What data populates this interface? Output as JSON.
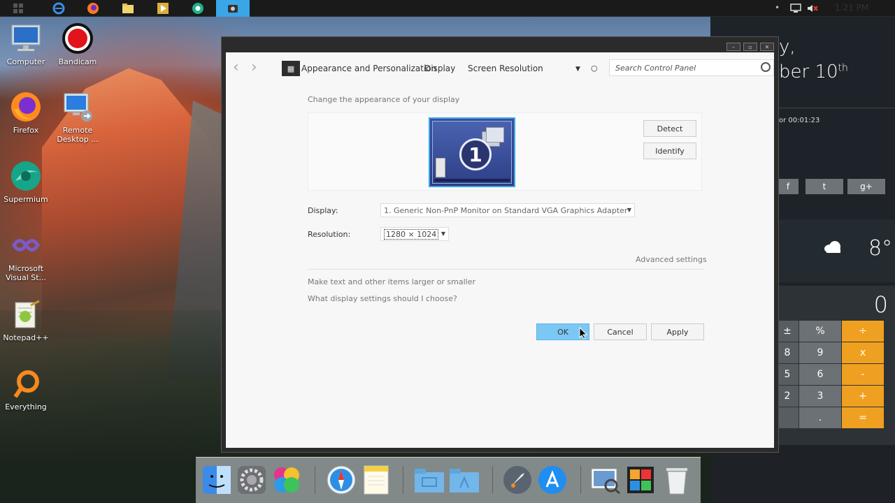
{
  "taskbar": {
    "apps": [
      "windows-logo",
      "internet-explorer",
      "firefox",
      "file-explorer",
      "media-player",
      "supermium",
      "bandicam"
    ],
    "active_app": "bandicam",
    "time": "1:21 PM"
  },
  "desktop_icons": [
    {
      "label": "Computer",
      "icon": "computer-icon"
    },
    {
      "label": "Bandicam",
      "icon": "bandicam-icon"
    },
    {
      "label": "Firefox",
      "icon": "firefox-icon"
    },
    {
      "label": "Remote Desktop ...",
      "icon": "remote-desktop-icon"
    },
    {
      "label": "Supermium",
      "icon": "supermium-icon"
    },
    {
      "label": "Microsoft Visual St...",
      "icon": "visual-studio-icon"
    },
    {
      "label": "Notepad++",
      "icon": "notepad-plus-plus-icon"
    },
    {
      "label": "Everything",
      "icon": "everything-icon"
    }
  ],
  "side_panel": {
    "day_fragment": "y,",
    "date_fragment": "ber 10",
    "date_suffix": "th",
    "timer": "or 00:01:23",
    "social": [
      "f",
      "t",
      "g+"
    ],
    "temperature": "8°",
    "calculator": {
      "display": "0",
      "keys": [
        [
          "±",
          "%",
          "÷"
        ],
        [
          "8",
          "9",
          "x"
        ],
        [
          "5",
          "6",
          "-"
        ],
        [
          "2",
          "3",
          "+"
        ],
        [
          "",
          ".",
          "="
        ]
      ]
    }
  },
  "window": {
    "breadcrumb": [
      "Appearance and Personalization",
      "Display",
      "Screen Resolution"
    ],
    "search_placeholder": "Search Control Panel",
    "heading": "Change the appearance of your display",
    "monitor_number": "1",
    "detect_label": "Detect",
    "identify_label": "Identify",
    "display_label": "Display:",
    "display_value": "1. Generic Non-PnP Monitor on Standard VGA Graphics Adapter",
    "resolution_label": "Resolution:",
    "resolution_value": "1280 × 1024",
    "advanced_label": "Advanced settings",
    "link_text_size": "Make text and other items larger or smaller",
    "link_which_settings": "What display settings should I choose?",
    "ok_label": "OK",
    "cancel_label": "Cancel",
    "apply_label": "Apply",
    "colors": {
      "accent": "#3aa6e8",
      "ok_button": "#7cc8f4"
    }
  },
  "dock": [
    "finder",
    "system-preferences",
    "game-center",
    "safari",
    "notes",
    "folder-1",
    "folder-2",
    "launchpad",
    "app-store",
    "preview",
    "photo-booth",
    "trash"
  ]
}
